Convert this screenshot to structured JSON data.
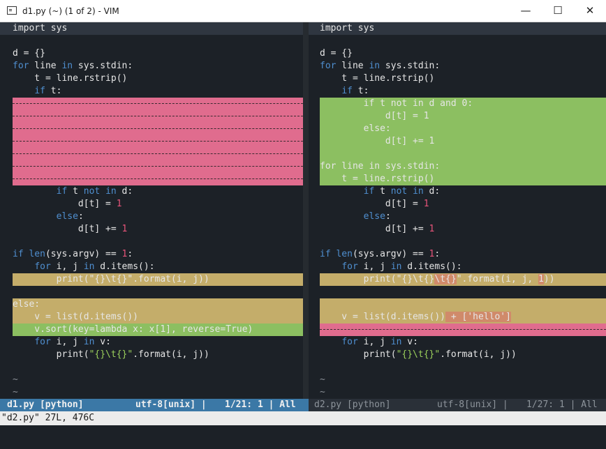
{
  "window": {
    "title": "d1.py (~) (1 of 2) - VIM",
    "minimize_glyph": "—",
    "maximize_glyph": "☐",
    "close_glyph": "✕"
  },
  "left": {
    "l1": "import sys",
    "l2a": "d = {}",
    "l3_kw": "for",
    "l3_a": " line ",
    "l3_kw2": "in",
    "l3_b": " sys.stdin:",
    "l4": "    t = line.rstrip()",
    "l5_pre": "    ",
    "l5_kw": "if",
    "l5_post": " t:",
    "l6_pre": "        ",
    "l6_kw": "if",
    "l6_a": " t ",
    "l6_kw2": "not in",
    "l6_b": " d:",
    "l7_a": "            d[t] = ",
    "l7_num": "1",
    "l8_pre": "        ",
    "l8_kw": "else",
    "l8_post": ":",
    "l9_a": "            d[t] += ",
    "l9_num": "1",
    "l10_kw": "if",
    "l10_a": " ",
    "l10_kw2": "len",
    "l10_b": "(sys.argv) == ",
    "l10_num": "1",
    "l10_c": ":",
    "l11_pre": "    ",
    "l11_kw": "for",
    "l11_a": " i, j ",
    "l11_kw2": "in",
    "l11_b": " d.items():",
    "l12_a": "        print(\"{}\\t{}",
    "l12_b": "\".format(i, j))",
    "l13": "else:",
    "l14": "    v = list(d.items())",
    "l15": "    v.sort(key=lambda x: x[1], reverse=True)",
    "l16_pre": "    ",
    "l16_kw": "for",
    "l16_a": " i, j ",
    "l16_kw2": "in",
    "l16_b": " v:",
    "l17_a": "        print(",
    "l17_str": "\"{}\\t{}\"",
    "l17_b": ".format(i, j))",
    "tilde": "~"
  },
  "right": {
    "r1": "import sys",
    "r2": "d = {}",
    "r3_kw": "for",
    "r3_a": " line ",
    "r3_kw2": "in",
    "r3_b": " sys.stdin:",
    "r4": "    t = line.rstrip()",
    "r5_pre": "    ",
    "r5_kw": "if",
    "r5_post": " t:",
    "a1": "        if t not in d and 0:",
    "a2": "            d[t] = 1",
    "a3": "        else:",
    "a4": "            d[t] += 1",
    "a5": "",
    "a6": "for line in sys.stdin:",
    "a7": "    t = line.rstrip()",
    "r6_pre": "        ",
    "r6_kw": "if",
    "r6_a": " t ",
    "r6_kw2": "not in",
    "r6_b": " d:",
    "r7_a": "            d[t] = ",
    "r7_num": "1",
    "r8_pre": "        ",
    "r8_kw": "else",
    "r8_post": ":",
    "r9_a": "            d[t] += ",
    "r9_num": "1",
    "r10_kw": "if",
    "r10_a": " ",
    "r10_kw2": "len",
    "r10_b": "(sys.argv) == ",
    "r10_num": "1",
    "r10_c": ":",
    "r11_pre": "    ",
    "r11_kw": "for",
    "r11_a": " i, j ",
    "r11_kw2": "in",
    "r11_b": " d.items():",
    "r12_a": "        print(\"{}\\t{}",
    "r12_txt": "\\t{}",
    "r12_b": "\".format(i, j, ",
    "r12_txt2": "1",
    "r12_c": "))",
    "r14_a": "    v = list(d.items())",
    "r14_txt": " + ['hello']",
    "r16_pre": "    ",
    "r16_kw": "for",
    "r16_a": " i, j ",
    "r16_kw2": "in",
    "r16_b": " v:",
    "r17_a": "        print(",
    "r17_str": "\"{}\\t{}\"",
    "r17_b": ".format(i, j))",
    "tilde": "~"
  },
  "statusbar": {
    "left_file": "d1.py [python]",
    "left_enc": "utf-8[unix] |",
    "left_pos": "1/21: 1 | All",
    "right_file": "d2.py [python]",
    "right_enc": "utf-8[unix] |",
    "right_pos": "1/27: 1 | All"
  },
  "cmdline": {
    "text": "\"d2.py\" 27L, 476C"
  },
  "colors": {
    "background": "#1c2127",
    "deleted": "#e06c8e",
    "added": "#8cbf61",
    "changed": "#c4ad6a",
    "changed_text": "#d08a6a",
    "keyword": "#4f8fd0",
    "number": "#e8547a",
    "string": "#9bd05b",
    "status_active": "#3b78a6"
  }
}
